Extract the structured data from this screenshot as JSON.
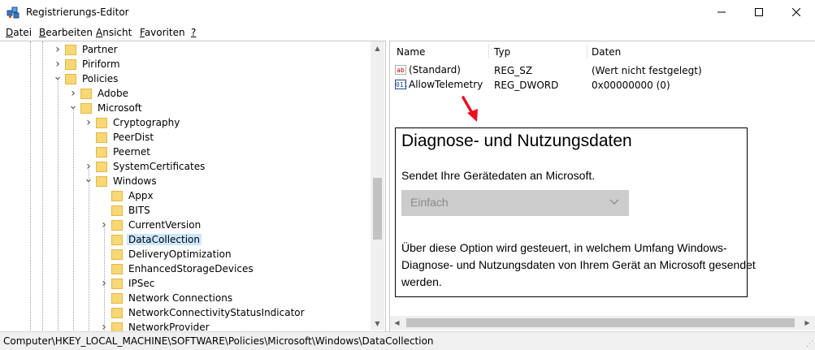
{
  "window": {
    "title": "Registrierungs-Editor",
    "controls": [
      "minimize",
      "maximize",
      "close"
    ]
  },
  "menu": [
    {
      "label": "Datei",
      "accel": "D"
    },
    {
      "label": "Bearbeiten",
      "accel": "B"
    },
    {
      "label": "Ansicht",
      "accel": "A"
    },
    {
      "label": "Favoriten",
      "accel": "F"
    },
    {
      "label": "?",
      "accel": "?"
    }
  ],
  "tree": [
    {
      "label": "Partner",
      "level": 0,
      "expander": "collapsed"
    },
    {
      "label": "Piriform",
      "level": 0,
      "expander": "collapsed"
    },
    {
      "label": "Policies",
      "level": 0,
      "expander": "expanded"
    },
    {
      "label": "Adobe",
      "level": 1,
      "expander": "collapsed"
    },
    {
      "label": "Microsoft",
      "level": 1,
      "expander": "expanded"
    },
    {
      "label": "Cryptography",
      "level": 2,
      "expander": "collapsed"
    },
    {
      "label": "PeerDist",
      "level": 2,
      "expander": "none"
    },
    {
      "label": "Peernet",
      "level": 2,
      "expander": "none"
    },
    {
      "label": "SystemCertificates",
      "level": 2,
      "expander": "collapsed"
    },
    {
      "label": "Windows",
      "level": 2,
      "expander": "expanded"
    },
    {
      "label": "Appx",
      "level": 3,
      "expander": "none"
    },
    {
      "label": "BITS",
      "level": 3,
      "expander": "none"
    },
    {
      "label": "CurrentVersion",
      "level": 3,
      "expander": "collapsed"
    },
    {
      "label": "DataCollection",
      "level": 3,
      "expander": "none",
      "selected": true
    },
    {
      "label": "DeliveryOptimization",
      "level": 3,
      "expander": "none"
    },
    {
      "label": "EnhancedStorageDevices",
      "level": 3,
      "expander": "none"
    },
    {
      "label": "IPSec",
      "level": 3,
      "expander": "collapsed"
    },
    {
      "label": "Network Connections",
      "level": 3,
      "expander": "none"
    },
    {
      "label": "NetworkConnectivityStatusIndicator",
      "level": 3,
      "expander": "none"
    },
    {
      "label": "NetworkProvider",
      "level": 3,
      "expander": "collapsed"
    }
  ],
  "values_table": {
    "columns": [
      "Name",
      "Typ",
      "Daten"
    ],
    "rows": [
      {
        "icon": "string-value-icon",
        "icon_glyph": "ab",
        "name": "(Standard)",
        "type": "REG_SZ",
        "data": "(Wert nicht festgelegt)"
      },
      {
        "icon": "binary-value-icon",
        "icon_glyph": "011",
        "name": "AllowTelemetry",
        "type": "REG_DWORD",
        "data": "0x00000000 (0)"
      }
    ]
  },
  "settings_overlay": {
    "title": "Diagnose- und Nutzungsdaten",
    "subtitle": "Sendet Ihre Gerätedaten an Microsoft.",
    "select_value": "Einfach",
    "description": "Über diese Option wird gesteuert, in welchem Umfang Windows-Diagnose- und Nutzungsdaten von Ihrem Gerät an Microsoft gesendet werden.",
    "select_enabled": false
  },
  "annotation_arrow_color": "#e81123",
  "status": {
    "path": "Computer\\HKEY_LOCAL_MACHINE\\SOFTWARE\\Policies\\Microsoft\\Windows\\DataCollection"
  },
  "colors": {
    "folder": "#f8d775",
    "selection": "#cce8ff",
    "disabled_select_bg": "#cccccc"
  }
}
